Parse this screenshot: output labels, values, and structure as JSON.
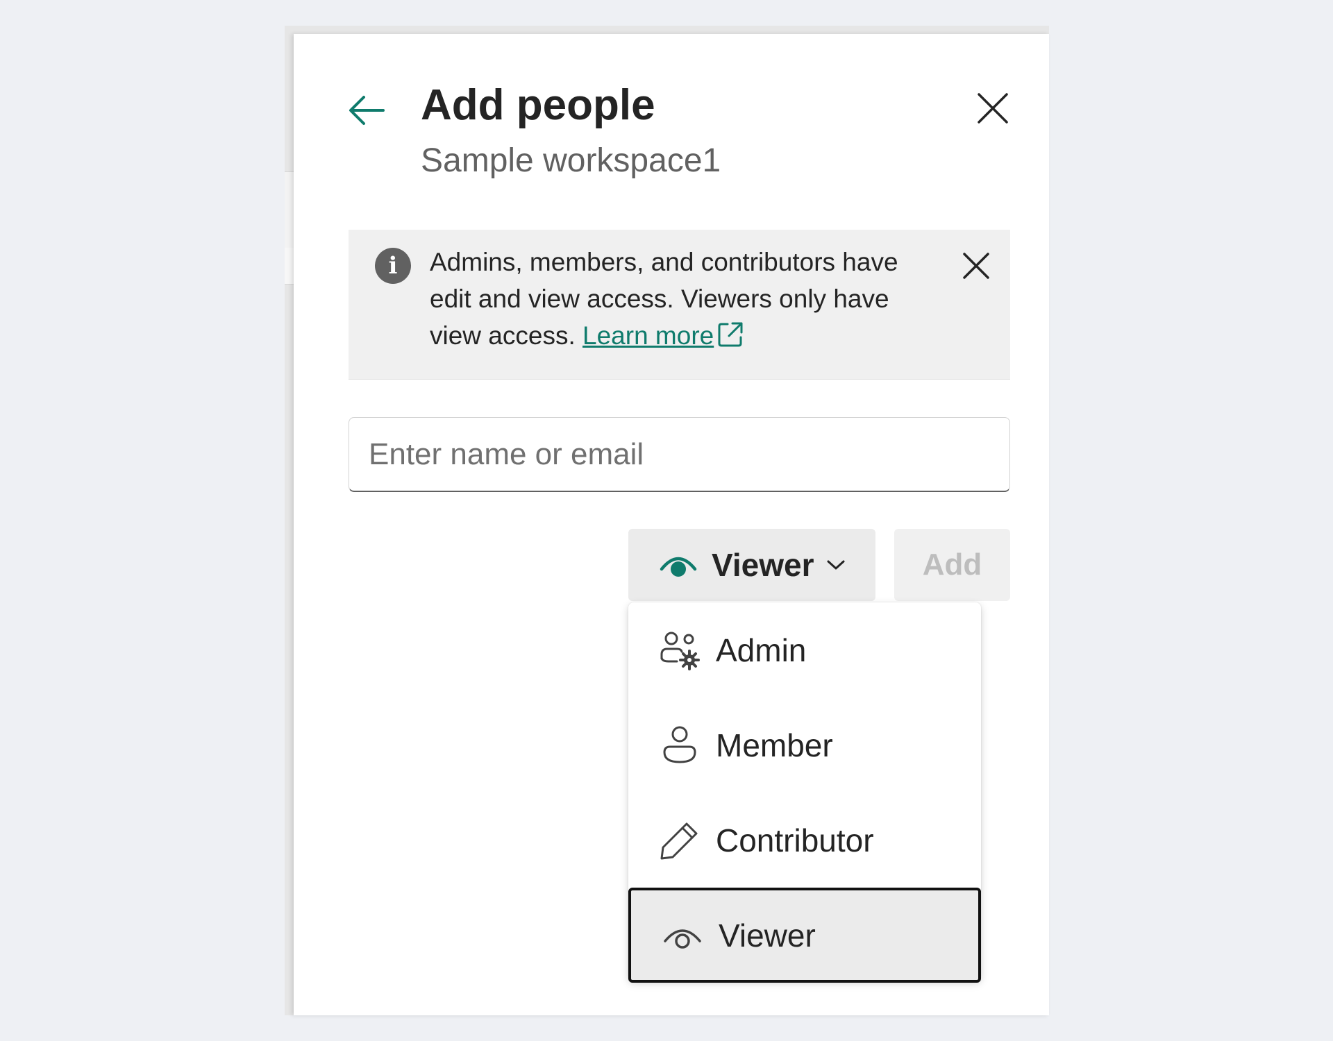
{
  "dialog": {
    "title": "Add people",
    "subtitle": "Sample workspace1"
  },
  "info": {
    "text": "Admins, members, and contributors have edit and view access. Viewers only have view access.",
    "link_label": "Learn more"
  },
  "input": {
    "placeholder": "Enter name or email",
    "value": ""
  },
  "role_dropdown": {
    "selected": "Viewer",
    "options": [
      {
        "label": "Admin",
        "icon": "people-settings-icon"
      },
      {
        "label": "Member",
        "icon": "person-icon"
      },
      {
        "label": "Contributor",
        "icon": "pencil-icon"
      },
      {
        "label": "Viewer",
        "icon": "eye-icon"
      }
    ]
  },
  "add_button": {
    "label": "Add",
    "enabled": false
  },
  "colors": {
    "accent": "#0f7b6c",
    "text": "#242424",
    "muted": "#616161"
  }
}
